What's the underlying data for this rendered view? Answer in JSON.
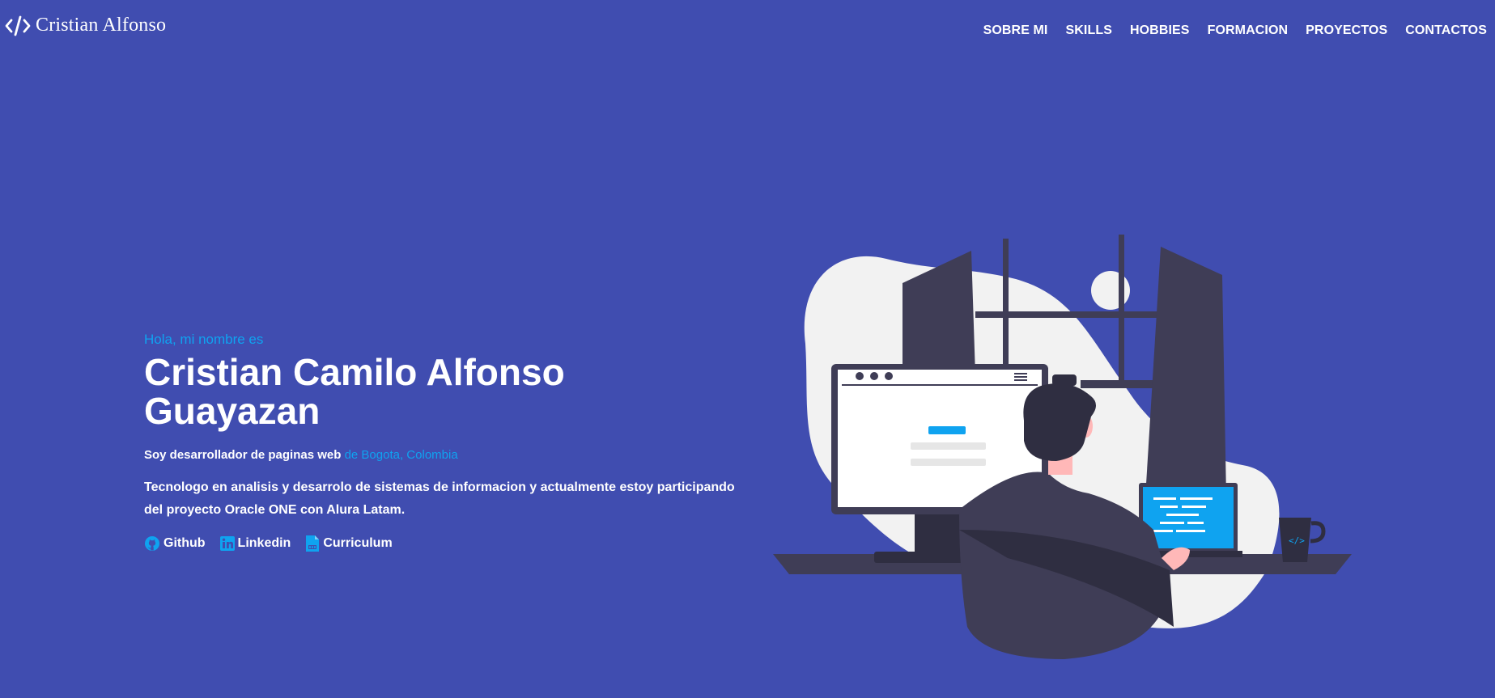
{
  "header": {
    "brand": "Cristian Alfonso",
    "nav": [
      "SOBRE MI",
      "SKILLS",
      "HOBBIES",
      "FORMACION",
      "PROYECTOS",
      "CONTACTOS"
    ]
  },
  "hero": {
    "greeting": "Hola, mi nombre es",
    "name_line1": "Cristian Camilo Alfonso",
    "name_line2": "Guayazan",
    "role_text": "Soy desarrollador de paginas web",
    "role_location": "de Bogota, Colombia",
    "description": "Tecnologo en analisis y desarrolo de sistemas de informacion y actualmente estoy participando del proyecto Oracle ONE con Alura Latam.",
    "links": {
      "github": "Github",
      "linkedin": "Linkedin",
      "curriculum": "Curriculum"
    }
  },
  "colors": {
    "background": "#404db0",
    "accent": "#0fa3f0",
    "text": "#ffffff",
    "dark": "#3f3d56"
  },
  "icons": [
    "code-icon",
    "github-icon",
    "linkedin-icon",
    "pdf-icon"
  ]
}
